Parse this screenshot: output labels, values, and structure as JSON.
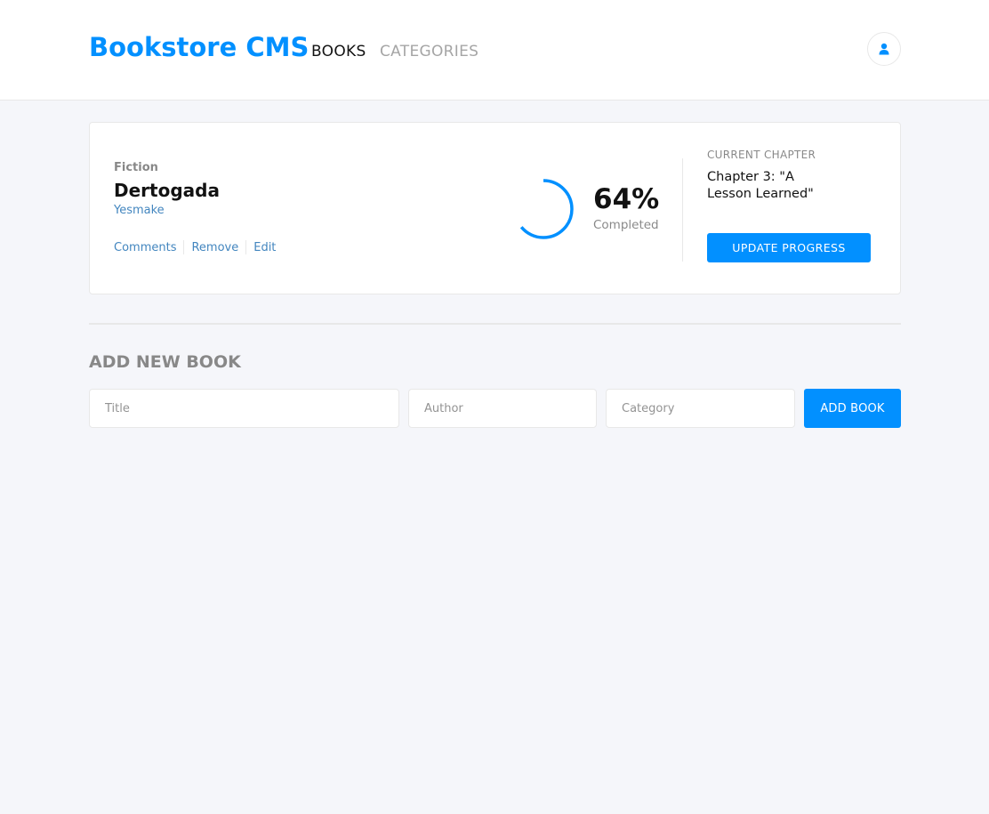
{
  "header": {
    "logo": "Bookstore CMS",
    "nav": {
      "books": "BOOKS",
      "categories": "CATEGORIES"
    },
    "user_icon": "user-icon"
  },
  "book": {
    "genre": "Fiction",
    "title": "Dertogada",
    "author": "Yesmake",
    "actions": {
      "comments": "Comments",
      "remove": "Remove",
      "edit": "Edit"
    },
    "progress": 0.64,
    "percent_label": "64%",
    "completed_label": "Completed",
    "current_chapter_label": "CURRENT CHAPTER",
    "current_chapter": "Chapter 3: \"A Lesson Learned\"",
    "update_button": "UPDATE PROGRESS"
  },
  "form": {
    "heading": "ADD NEW BOOK",
    "title_placeholder": "Title",
    "author_placeholder": "Author",
    "category_placeholder": "Category",
    "submit": "ADD BOOK"
  },
  "colors": {
    "accent": "#0290ff",
    "link": "#4386bf",
    "text": "#121212",
    "muted": "#888888",
    "background": "#f5f6fa",
    "ring_track": "#e8e8e8"
  }
}
